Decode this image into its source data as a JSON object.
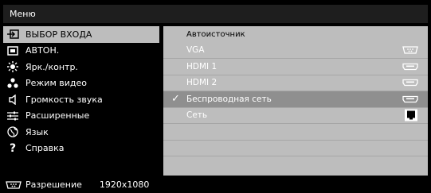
{
  "title": "Меню",
  "menu": [
    {
      "label": "ВЫБОР ВХОДА",
      "icon": "input-icon",
      "selected": true
    },
    {
      "label": "АВТОН.",
      "icon": "auto-adjust-icon"
    },
    {
      "label": "Ярк./контр.",
      "icon": "brightness-icon"
    },
    {
      "label": "Режим видео",
      "icon": "video-mode-icon"
    },
    {
      "label": "Громкость звука",
      "icon": "speaker-icon"
    },
    {
      "label": "Расширенные",
      "icon": "advanced-settings-icon"
    },
    {
      "label": "Язык",
      "icon": "language-globe-icon"
    },
    {
      "label": "Справка",
      "icon": "help-icon"
    }
  ],
  "submenu": {
    "header": "Автоисточник",
    "items": [
      {
        "label": "VGA",
        "icon": "vga-port-icon"
      },
      {
        "label": "HDMI 1",
        "icon": "hdmi-port-icon"
      },
      {
        "label": "HDMI 2",
        "icon": "hdmi-port-icon"
      },
      {
        "label": "Беспроводная сеть",
        "icon": "hdmi-port-icon",
        "checked": true
      },
      {
        "label": "Сеть",
        "icon": "network-port-icon"
      },
      {
        "label": ""
      },
      {
        "label": ""
      },
      {
        "label": ""
      }
    ]
  },
  "footer": {
    "resolution_label": "Разрешение",
    "resolution_value": "1920x1080"
  },
  "colors": {
    "title_bar": "#1e1e1e",
    "panel_bg": "#bdbdbd",
    "selected_row": "#8f8f8f"
  }
}
